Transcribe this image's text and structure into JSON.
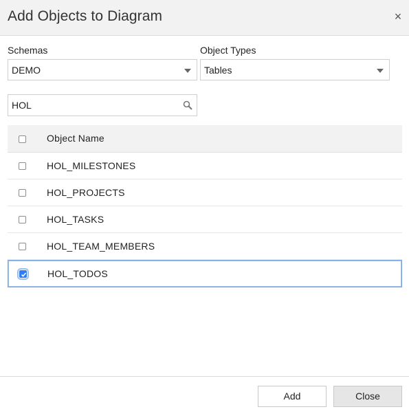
{
  "dialog": {
    "title": "Add Objects to Diagram",
    "close_glyph": "×"
  },
  "filters": {
    "schemas_label": "Schemas",
    "schemas_value": "DEMO",
    "object_types_label": "Object Types",
    "object_types_value": "Tables",
    "search_value": "HOL"
  },
  "table": {
    "header": "Object Name",
    "rows": [
      {
        "name": "HOL_MILESTONES",
        "checked": false
      },
      {
        "name": "HOL_PROJECTS",
        "checked": false
      },
      {
        "name": "HOL_TASKS",
        "checked": false
      },
      {
        "name": "HOL_TEAM_MEMBERS",
        "checked": false
      },
      {
        "name": "HOL_TODOS",
        "checked": true
      }
    ]
  },
  "footer": {
    "add_label": "Add",
    "close_label": "Close"
  },
  "colors": {
    "accent": "#2f7cf6",
    "selection_border": "#7aa7e0"
  }
}
